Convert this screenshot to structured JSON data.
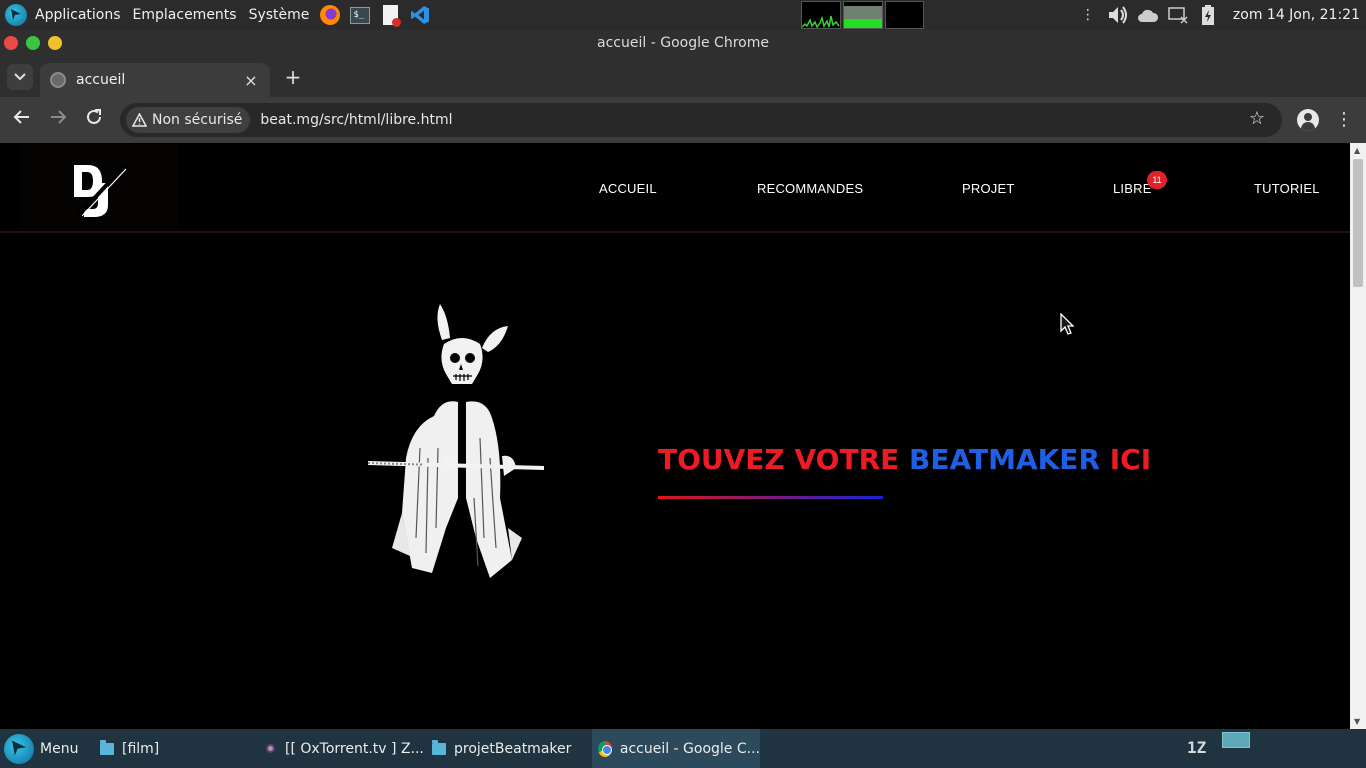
{
  "panel": {
    "applications": "Applications",
    "places": "Emplacements",
    "system": "Système",
    "clock": "zom 14 Jon, 21:21"
  },
  "window": {
    "title": "accueil - Google Chrome"
  },
  "browser": {
    "tab_title": "accueil",
    "tab_close": "×",
    "new_tab": "+",
    "security_label": "Non sécurisé",
    "url": "beat.mg/src/html/libre.html"
  },
  "site": {
    "logo_text": "DJ",
    "nav": [
      {
        "label": "ACCUEIL"
      },
      {
        "label": "RECOMMANDES"
      },
      {
        "label": "PROJET"
      },
      {
        "label": "LIBRE"
      },
      {
        "label": "TUTORIEL"
      }
    ],
    "libre_badge": "11",
    "hero": {
      "heading_part1": "TOUVEZ VOTRE ",
      "heading_part2": "BEATMAKER ",
      "heading_part3": "ICI"
    }
  },
  "taskbar": {
    "menu_label": "Menu",
    "tasks": [
      {
        "label": "[film]"
      },
      {
        "label": "[[ OxTorrent.tv ] Z..."
      },
      {
        "label": "projetBeatmaker"
      },
      {
        "label": "accueil - Google C..."
      }
    ]
  },
  "colors": {
    "heading_red": "#ed1c24",
    "heading_blue": "#1f5fe6",
    "badge_red": "#e0232b",
    "taskbar_bg": "#1f3340"
  }
}
